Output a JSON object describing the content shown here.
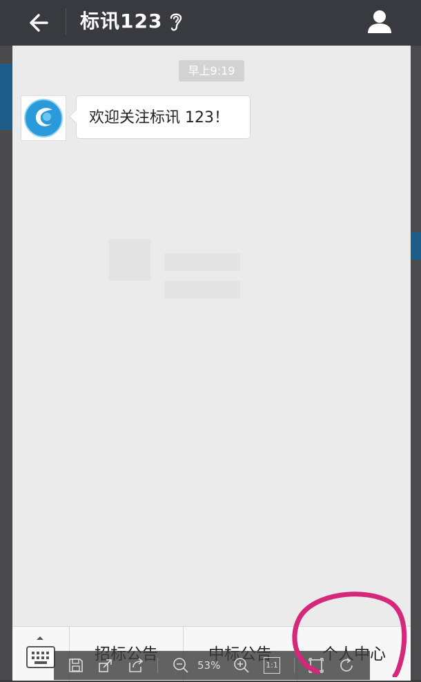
{
  "header": {
    "title": "标讯123"
  },
  "chat": {
    "timestamp": "早上9:19",
    "message": "欢迎关注标讯 123！"
  },
  "bottom_menu": {
    "items": [
      {
        "label": "招标公告"
      },
      {
        "label": "中标公告"
      },
      {
        "label": "个人中心"
      }
    ]
  },
  "viewer_toolbar": {
    "zoom": "53%",
    "actual_size_label": "1:1"
  },
  "colors": {
    "header_bg": "#393a3f",
    "chat_bg": "#ebebeb",
    "annotation": "#d6287a"
  }
}
